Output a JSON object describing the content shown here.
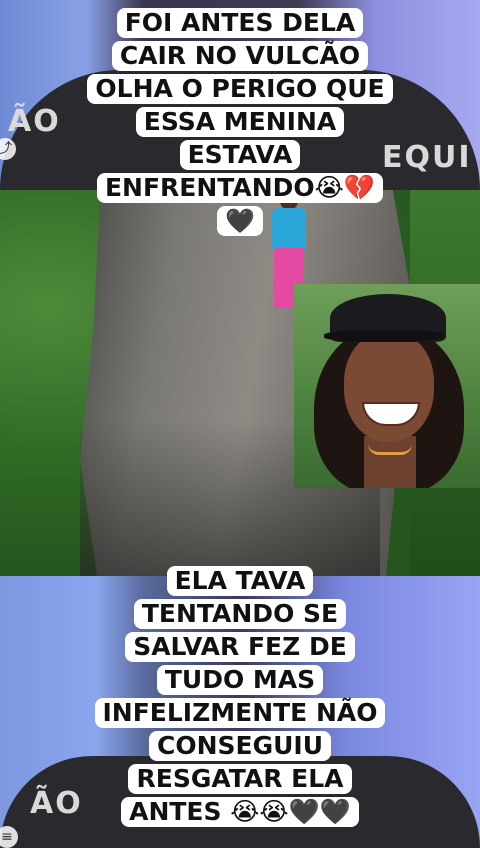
{
  "top_caption": {
    "lines": [
      "FOI ANTES DELA",
      "CAIR NO VULCÃO",
      "OLHA O PERIGO QUE",
      "ESSA MENINA",
      "ESTAVA",
      "ENFRENTANDO😭💔",
      "🖤"
    ]
  },
  "bottom_caption": {
    "lines": [
      "ELA TAVA",
      "TENTANDO SE",
      "SALVAR FEZ DE",
      "TUDO MAS",
      "INFELIZMENTE NÃO",
      "CONSEGUIU",
      "RESGATAR ELA",
      "ANTES 😭😭🖤🖤"
    ]
  },
  "background_text": {
    "top_left": "ÃO",
    "top_right": "EQUI",
    "bottom_left": "ÃO"
  },
  "icons": {
    "top_left": "share-icon",
    "bottom_left": "menu-icon"
  },
  "colors": {
    "caption_bg": "#ffffff",
    "caption_text": "#111111",
    "shirt": "#2aa6d8",
    "pants": "#e34ba3"
  }
}
